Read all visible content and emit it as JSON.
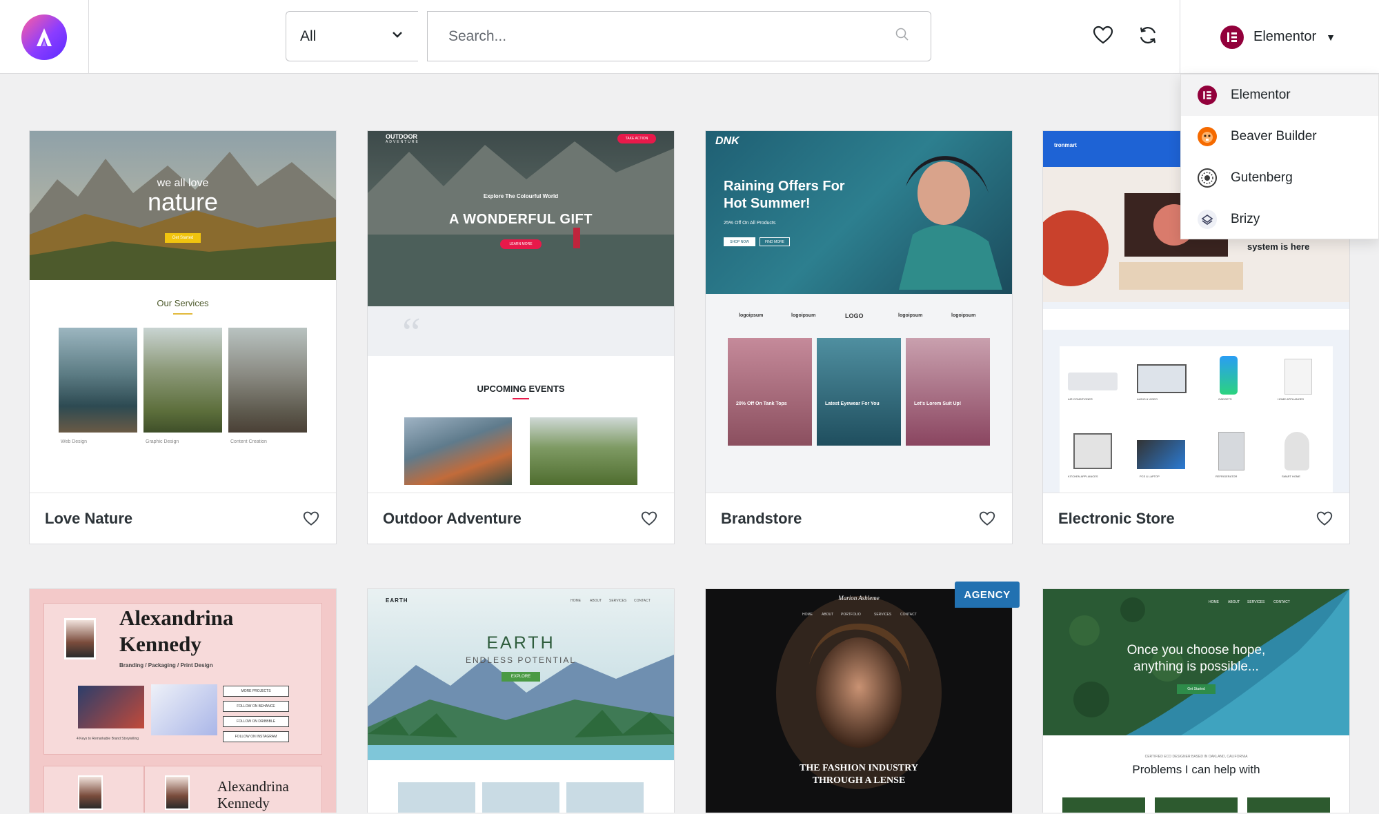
{
  "header": {
    "filter_value": "All",
    "search_placeholder": "Search...",
    "builder_selected": "Elementor"
  },
  "dropdown": {
    "items": [
      {
        "label": "Elementor"
      },
      {
        "label": "Beaver Builder"
      },
      {
        "label": "Gutenberg"
      },
      {
        "label": "Brizy"
      }
    ]
  },
  "colors": {
    "accent": "#2271b1",
    "elementor": "#92003b",
    "beaver": "#f56a00"
  },
  "cards": [
    {
      "title": "Love Nature",
      "preview": {
        "hero_small": "we all love",
        "hero_big": "nature",
        "button": "Get Started",
        "section": "Our Services",
        "services": [
          "Web Design",
          "Graphic Design",
          "Content Creation"
        ]
      }
    },
    {
      "title": "Outdoor Adventure",
      "preview": {
        "logo": "OUTDOOR",
        "logo_sub": "ADVENTURE",
        "cta": "TAKE ACTION",
        "kicker": "Explore The Colourful World",
        "hero": "A WONDERFUL GIFT",
        "button": "LEARN MORE",
        "section": "UPCOMING EVENTS"
      }
    },
    {
      "title": "Brandstore",
      "preview": {
        "logo": "DNK",
        "hero": "Raining Offers For Hot Summer!",
        "sub": "25% Off On All Products",
        "btn1": "SHOP NOW",
        "btn2": "FIND MORE",
        "logos": [
          "logoipsum",
          "logoipsum",
          "LOGO",
          "logoipsum",
          "logoipsum"
        ],
        "tiles": [
          "20% Off On Tank Tops",
          "Latest Eyewear For You",
          "Let's Lorem Suit Up!"
        ]
      }
    },
    {
      "title": "Electronic Store",
      "preview": {
        "logo": "tronmart",
        "hero": "system is here",
        "products": [
          "AIR CONDITIONER",
          "AUDIO & VIDEO",
          "GADGETS",
          "HOME APPLIANCES",
          "KITCHEN APPLIANCES",
          "PCS & LAPTOP",
          "REFRIGERATOR",
          "SMART HOME"
        ]
      }
    },
    {
      "title": "",
      "preview": {
        "name_line1": "Alexandrina",
        "name_line2": "Kennedy",
        "tagline": "Branding / Packaging / Print Design",
        "buttons": [
          "MORE PROJECTS",
          "FOLLOW ON BEHANCE",
          "FOLLOW ON DRIBBBLE",
          "FOLLOW ON INSTAGRAM"
        ],
        "caption": "4 Keys to Remarkable Brand Storytelling"
      }
    },
    {
      "title": "",
      "preview": {
        "logo": "EARTH",
        "nav": [
          "HOME",
          "ABOUT",
          "SERVICES",
          "CONTACT"
        ],
        "hero": "EARTH",
        "sub": "ENDLESS POTENTIAL",
        "button": "EXPLORE"
      }
    },
    {
      "title": "",
      "badge": "AGENCY",
      "preview": {
        "logo": "Marion Ashleme",
        "nav": [
          "HOME",
          "ABOUT",
          "PORTFOLIO",
          "SERVICES",
          "CONTACT"
        ],
        "hero_line1": "THE FASHION INDUSTRY",
        "hero_line2": "THROUGH A LENSE"
      }
    },
    {
      "title": "",
      "preview": {
        "nav": [
          "HOME",
          "ABOUT",
          "SERVICES",
          "CONTACT"
        ],
        "hero_line1": "Once you choose hope,",
        "hero_line2": "anything is possible...",
        "button": "Get Started",
        "kicker": "CERTIFIED ECO DESIGNER BASED IN OAKLAND, CALIFORNIA",
        "section": "Problems I can help with"
      }
    }
  ]
}
